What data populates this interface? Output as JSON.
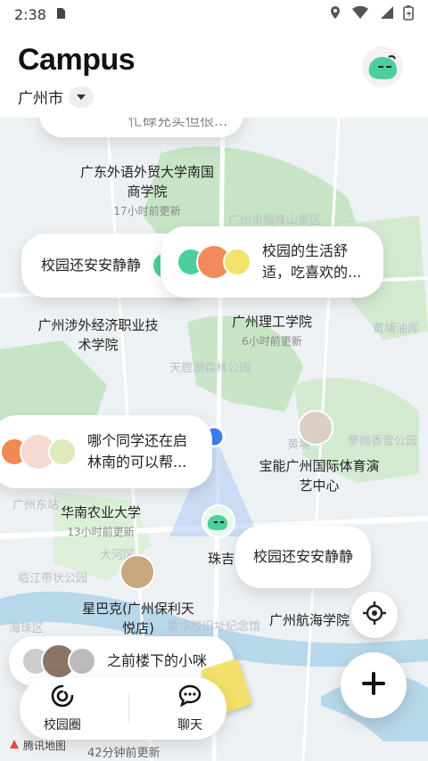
{
  "status": {
    "time": "2:38"
  },
  "header": {
    "brand": "Campus",
    "city": "广州市"
  },
  "map": {
    "top_cut_text": "忙碌充实但很...",
    "places": [
      {
        "name": "广东外语外贸大学南国商学院",
        "sub": "17小时前更新"
      },
      {
        "name": "广州涉外经济职业技术学院",
        "sub": ""
      },
      {
        "name": "广州理工学院",
        "sub": "6小时前更新"
      },
      {
        "name": "宝能广州国际体育演艺中心",
        "sub": ""
      },
      {
        "name": "华南农业大学",
        "sub": "13小时前更新"
      },
      {
        "name": "珠吉",
        "sub": ""
      },
      {
        "name": "星巴克(广州保利天悦店)",
        "sub": ""
      },
      {
        "name": "广州航海学院",
        "sub": ""
      }
    ],
    "faint_labels": [
      "广州市帽峰山景区",
      "黄埔油库",
      "天鹿湖森林公园",
      "萝岗香雪公园",
      "广州东站",
      "大河区",
      "临江带状公园",
      "海珠区",
      "黄华校旧址纪念馆",
      "黄埔"
    ],
    "bubbles": [
      {
        "text": "校园还安安静静"
      },
      {
        "text": "校园的生活舒适，吃喜欢的..."
      },
      {
        "text": "哪个同学还在启林南的可以帮..."
      },
      {
        "text": "校园还安安静静"
      },
      {
        "text": "之前楼下的小咪"
      }
    ],
    "bottom_update": "42分钟前更新",
    "map_brand": "腾讯地图"
  },
  "tabs": [
    {
      "label": "校园圈",
      "icon": "campus-circle-icon"
    },
    {
      "label": "聊天",
      "icon": "chat-icon"
    }
  ],
  "fab": {
    "icon": "plus-icon"
  },
  "colors": {
    "accent": "#4ccf9a",
    "park": "#c7e5c6",
    "water": "#b7d7ea"
  }
}
